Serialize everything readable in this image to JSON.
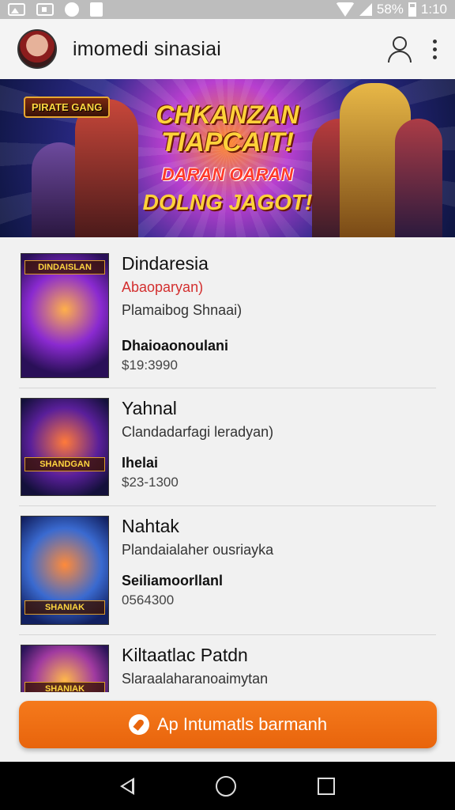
{
  "status_bar": {
    "battery": "58%",
    "time": "1:10"
  },
  "app_bar": {
    "title": "imomedi sinasiai"
  },
  "banner": {
    "logo_text": "PIRATE GANG",
    "line1": "CHKANZAN",
    "line2": "TIAPCAIT!",
    "line3": "DARAN OARAN",
    "line4": "DOLNG JAGOT!"
  },
  "games": [
    {
      "name": "Dindaresia",
      "subtitle": "Abaoparyan)",
      "detail": "Plamaibog Shnaai)",
      "label": "Dhaioaonoulani",
      "price": "$19:3990",
      "thumb_title": "DINDAISLAN"
    },
    {
      "name": "Yahnal",
      "subtitle": "Clandadarfagi leradyan)",
      "label": "Ihelai",
      "price": "$23-1300",
      "thumb_title": "SHANDGAN"
    },
    {
      "name": "Nahtak",
      "subtitle": "Plandaialaher ousriayka",
      "label": "Seiliamoorllanl",
      "price": "0564300",
      "thumb_title": "SHANIAK"
    },
    {
      "name": "Kiltaatlac Patdn",
      "subtitle": "Slaraalaharanoaimytan",
      "thumb_title": "SHANIAK"
    }
  ],
  "cta": {
    "label": "Ap Intumatls barmanh"
  },
  "icons": {
    "profile": "person-outline-icon",
    "more": "more-vertical-icon",
    "cta": "compass-icon",
    "nav_back": "back-triangle-icon",
    "nav_home": "home-circle-icon",
    "nav_recent": "recent-square-icon"
  },
  "colors": {
    "accent": "#F07018",
    "subtitle_red": "#D32F2F",
    "nav_bg": "#000000"
  }
}
